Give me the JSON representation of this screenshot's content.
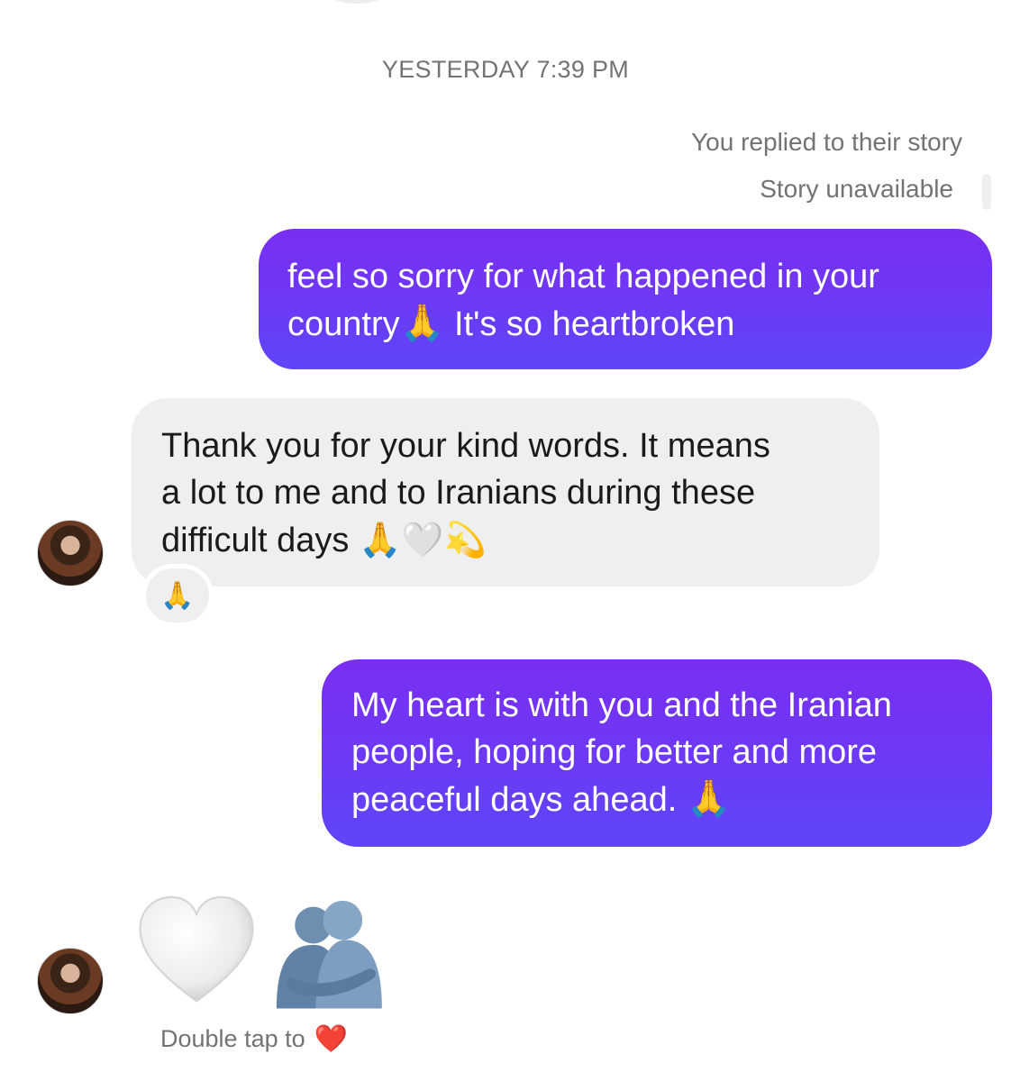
{
  "header": {
    "timestamp": "YESTERDAY 7:39 PM"
  },
  "story": {
    "reply_note": "You replied to their story",
    "unavailable_label": "Story unavailable"
  },
  "messages": [
    {
      "direction": "outgoing",
      "lines": [
        "feel so sorry for what happened in your",
        "country🙏 It's so heartbroken"
      ],
      "line_parts": {
        "l1": "feel so sorry for what happened in your",
        "l2a": "country",
        "l2_emoji": "🙏",
        "l2b": " It's so heartbroken"
      }
    },
    {
      "direction": "incoming",
      "line_parts": {
        "l1": "Thank you for your kind words. It means",
        "l2": "a lot to me and to Iranians during these",
        "l3": "difficult days ",
        "l3_emoji": "🙏🤍💫"
      },
      "reaction": "🙏"
    },
    {
      "direction": "outgoing",
      "line_parts": {
        "l1": "My heart is with you and the Iranian",
        "l2": "people, hoping for better and more",
        "l3": "peaceful days ahead. ",
        "l3_emoji": "🙏"
      }
    },
    {
      "direction": "incoming",
      "emoji_only": [
        "white-heart",
        "people-hugging"
      ]
    }
  ],
  "hint": {
    "text": "Double tap to",
    "emoji": "❤️"
  },
  "colors": {
    "outgoing_bubble": "#6a3bf6",
    "incoming_bubble": "#efefef",
    "meta_text": "#737373",
    "reaction_heart": "#ed2a3a"
  },
  "icons": {
    "avatar": "contact-avatar",
    "white_heart": "white-heart-icon",
    "hugging": "people-hugging-icon",
    "heart": "red-heart-icon"
  }
}
